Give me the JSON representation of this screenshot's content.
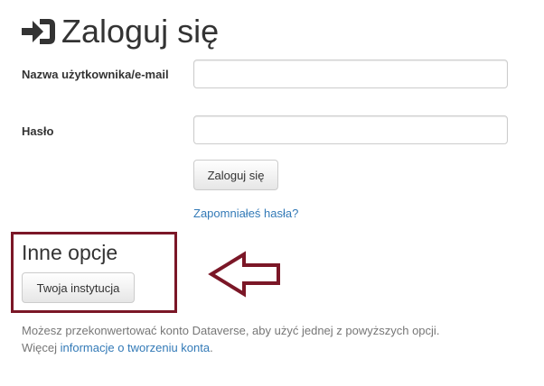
{
  "login": {
    "title": "Zaloguj się",
    "icon": "sign-in-icon"
  },
  "form": {
    "username_label": "Nazwa użytkownika/e-mail",
    "username_value": "",
    "password_label": "Hasło",
    "password_value": "",
    "submit_label": "Zaloguj się",
    "forgot_link": "Zapomniałeś hasła?"
  },
  "other_options": {
    "title": "Inne opcje",
    "institution_button": "Twoja instytucja"
  },
  "info": {
    "line1": "Możesz przekonwertować konto Dataverse, aby użyć jednej z powyższych opcji.",
    "line2_prefix": "Więcej ",
    "line2_link": "informacje o tworzeniu konta",
    "line2_suffix": "."
  },
  "colors": {
    "annotation": "#7b1727",
    "link": "#337ab7",
    "text": "#333333",
    "muted_text": "#777777"
  }
}
